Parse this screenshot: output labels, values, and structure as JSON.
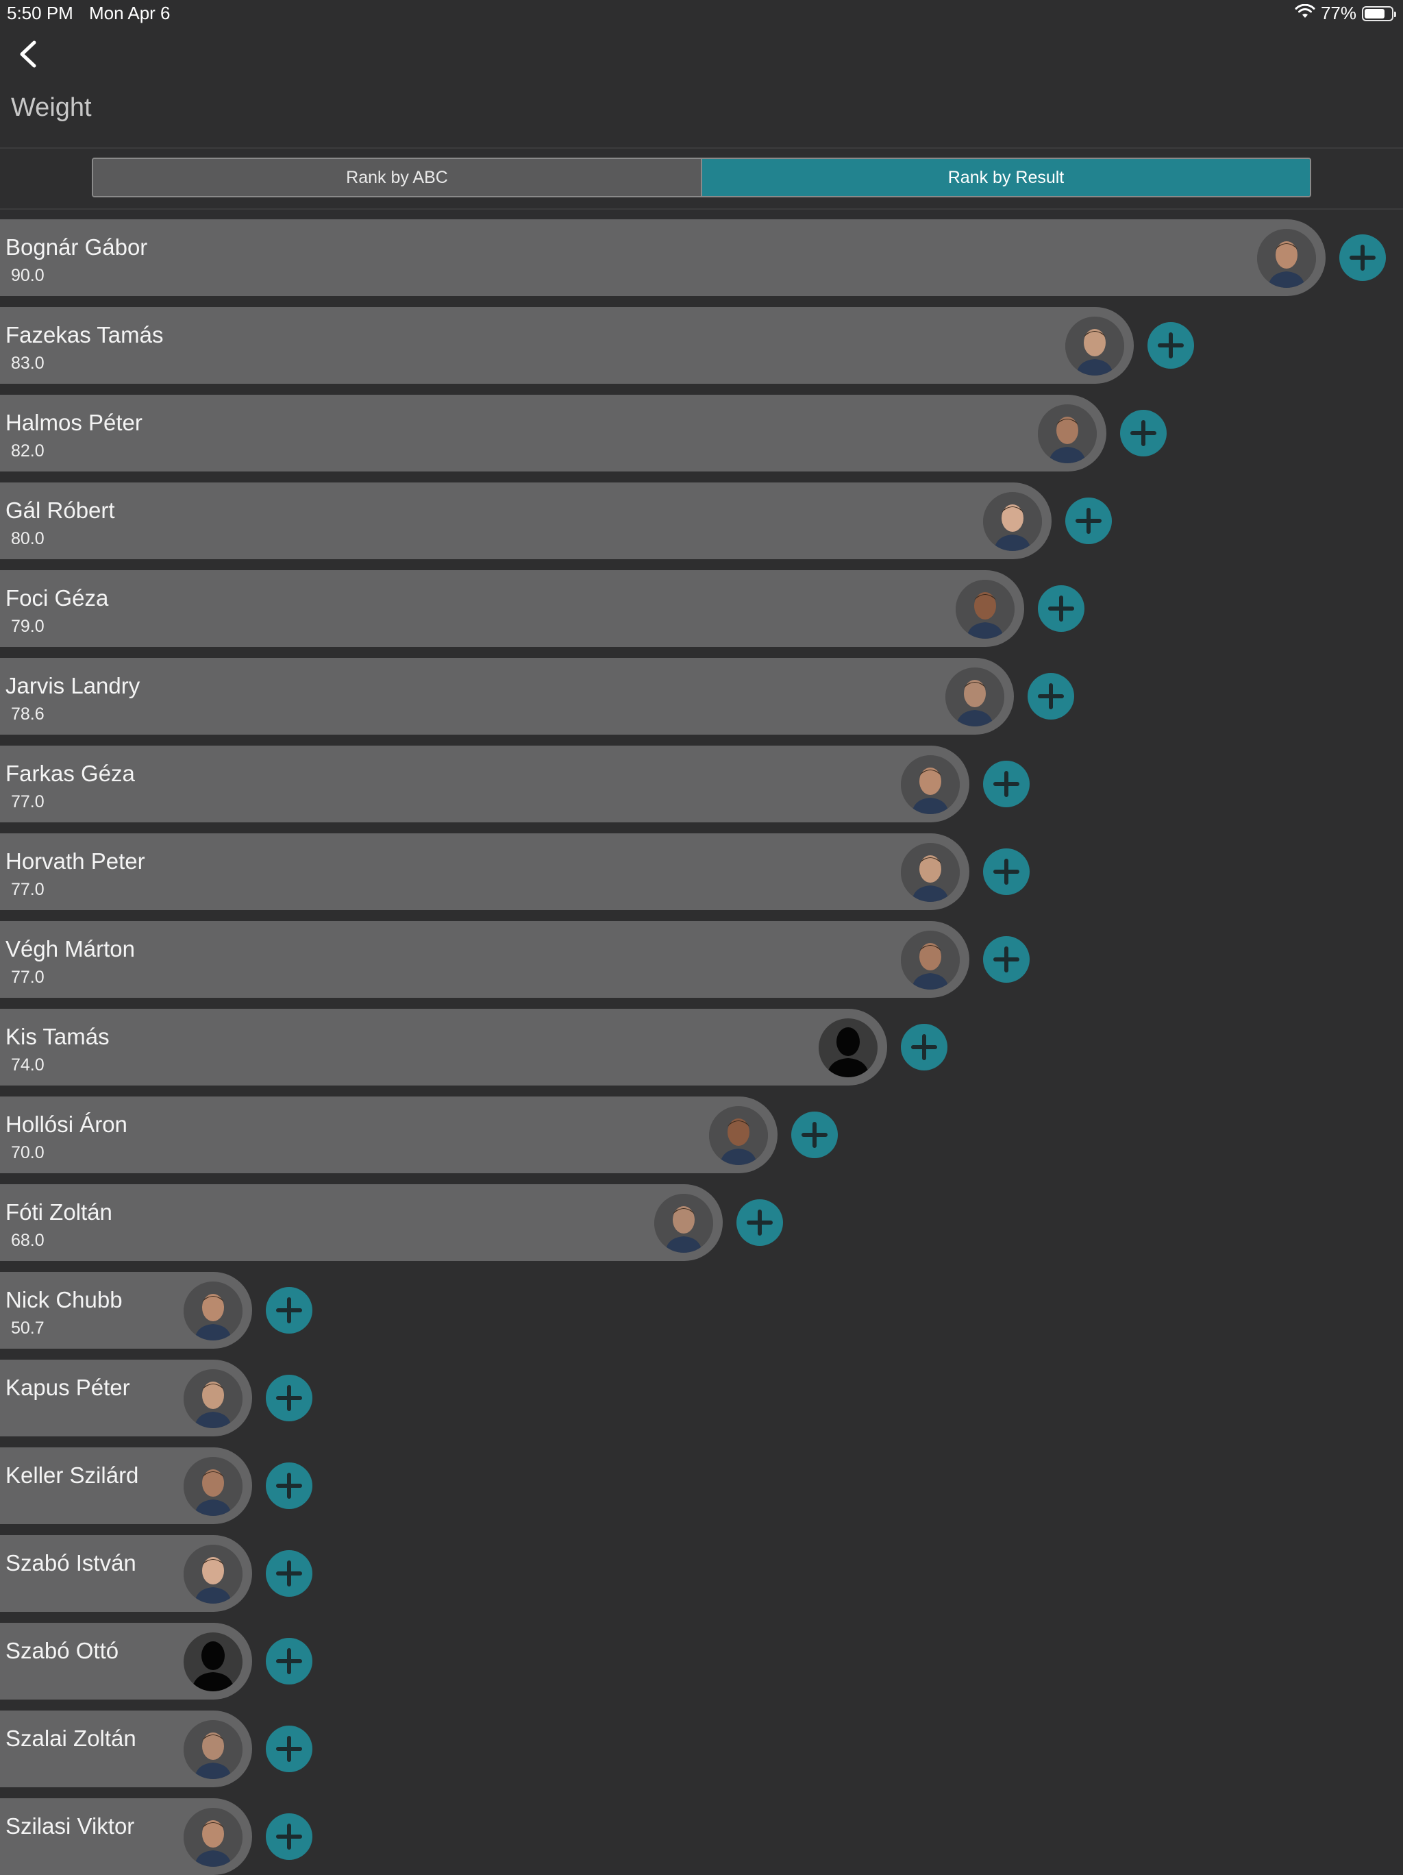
{
  "status_bar": {
    "time": "5:50 PM",
    "date": "Mon Apr 6",
    "battery": "77%",
    "battery_level": 0.77,
    "icons": [
      "wifi-icon",
      "battery-icon"
    ]
  },
  "nav": {
    "back_icon": "chevron-left-icon"
  },
  "page": {
    "title": "Weight"
  },
  "segmented_control": {
    "options": [
      "Rank by ABC",
      "Rank by Result"
    ],
    "selected": "Rank by Result"
  },
  "colors": {
    "background": "#2e2e2f",
    "bar": "#646465",
    "accent": "#22838f",
    "add_icon": "#1c2b2e"
  },
  "players": [
    {
      "name": "Bognár Gábor",
      "value": "90.0",
      "avatar": "photo"
    },
    {
      "name": "Fazekas Tamás",
      "value": "83.0",
      "avatar": "photo"
    },
    {
      "name": "Halmos Péter",
      "value": "82.0",
      "avatar": "photo"
    },
    {
      "name": "Gál Róbert",
      "value": "80.0",
      "avatar": "photo"
    },
    {
      "name": "Foci Géza",
      "value": "79.0",
      "avatar": "photo"
    },
    {
      "name": "Jarvis Landry",
      "value": "78.6",
      "avatar": "photo"
    },
    {
      "name": "Farkas Géza",
      "value": "77.0",
      "avatar": "photo"
    },
    {
      "name": "Horvath Peter",
      "value": "77.0",
      "avatar": "photo"
    },
    {
      "name": "Végh Márton",
      "value": "77.0",
      "avatar": "photo"
    },
    {
      "name": "Kis Tamás",
      "value": "74.0",
      "avatar": "silhouette"
    },
    {
      "name": "Hollósi Áron",
      "value": "70.0",
      "avatar": "photo"
    },
    {
      "name": "Fóti Zoltán",
      "value": "68.0",
      "avatar": "photo"
    },
    {
      "name": "Nick Chubb",
      "value": "50.7",
      "avatar": "photo"
    },
    {
      "name": "Kapus Péter",
      "value": "",
      "avatar": "photo"
    },
    {
      "name": "Keller Szilárd",
      "value": "",
      "avatar": "photo"
    },
    {
      "name": "Szabó István",
      "value": "",
      "avatar": "photo"
    },
    {
      "name": "Szabó Ottó",
      "value": "",
      "avatar": "silhouette"
    },
    {
      "name": "Szalai Zoltán",
      "value": "",
      "avatar": "photo"
    },
    {
      "name": "Szilasi Viktor",
      "value": "",
      "avatar": "photo"
    }
  ]
}
